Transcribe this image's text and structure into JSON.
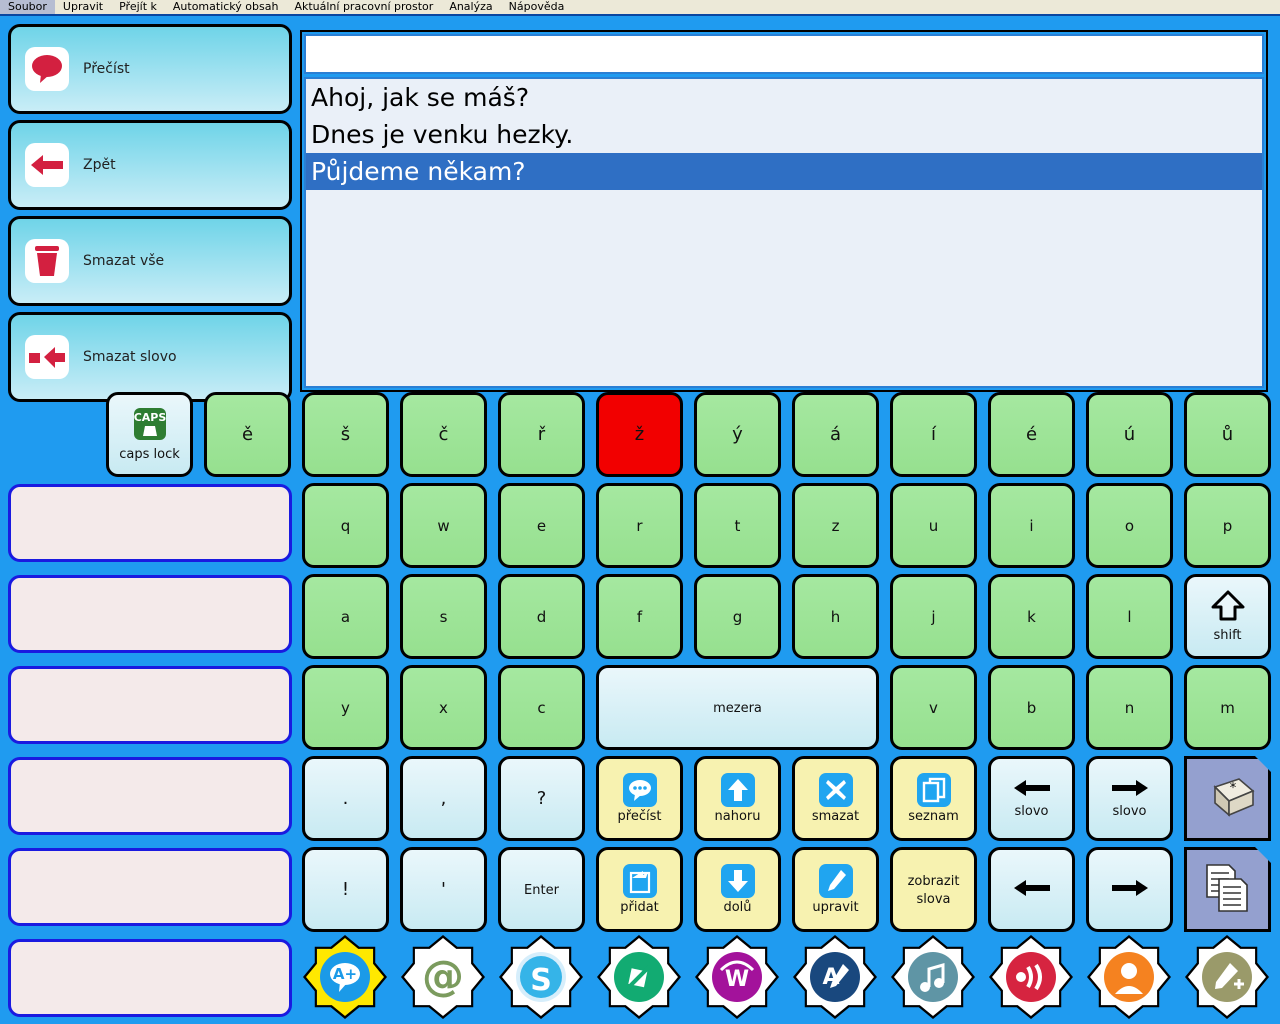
{
  "menu": {
    "items": [
      "Soubor",
      "Upravit",
      "Přejít k",
      "Automatický obsah",
      "Aktuální pracovní prostor",
      "Analýza",
      "Nápověda"
    ]
  },
  "sidebar": {
    "buttons": [
      {
        "label": "Přečíst",
        "icon": "speech-bubble-icon"
      },
      {
        "label": "Zpět",
        "icon": "arrow-left-icon"
      },
      {
        "label": "Smazat vše",
        "icon": "trash-icon"
      },
      {
        "label": "Smazat slovo",
        "icon": "delete-word-icon"
      }
    ],
    "empty_slots": 6
  },
  "text_area": {
    "entry_value": "",
    "sentences": [
      {
        "text": "Ahoj, jak se máš?",
        "selected": false
      },
      {
        "text": "Dnes je venku hezky.",
        "selected": false
      },
      {
        "text": "Půjdeme někam?",
        "selected": true
      }
    ]
  },
  "keyboard": {
    "caps": {
      "label": "caps lock",
      "badge": "CAPS",
      "icon": "caps-lock-icon"
    },
    "row1": [
      {
        "label": "ě",
        "style": "green"
      },
      {
        "label": "š",
        "style": "green"
      },
      {
        "label": "č",
        "style": "green"
      },
      {
        "label": "ř",
        "style": "green"
      },
      {
        "label": "ž",
        "style": "red"
      },
      {
        "label": "ý",
        "style": "green"
      },
      {
        "label": "á",
        "style": "green"
      },
      {
        "label": "í",
        "style": "green"
      },
      {
        "label": "é",
        "style": "green"
      },
      {
        "label": "ú",
        "style": "green"
      },
      {
        "label": "ů",
        "style": "green"
      }
    ],
    "row2": [
      "q",
      "w",
      "e",
      "r",
      "t",
      "z",
      "u",
      "i",
      "o",
      "p"
    ],
    "row3": [
      "a",
      "s",
      "d",
      "f",
      "g",
      "h",
      "j",
      "k",
      "l"
    ],
    "shift": {
      "label": "shift",
      "icon": "shift-arrow-icon"
    },
    "row4_left": [
      "y",
      "x",
      "c"
    ],
    "space": {
      "label": "mezera"
    },
    "row4_right": [
      "v",
      "b",
      "n",
      "m"
    ],
    "row5_punct": [
      {
        "label": ".",
        "name": "period"
      },
      {
        "label": ",",
        "name": "comma"
      },
      {
        "label": "?",
        "name": "question-mark"
      }
    ],
    "row6_punct": [
      {
        "label": "!",
        "name": "exclamation"
      },
      {
        "label": "'",
        "name": "apostrophe"
      },
      {
        "label": "Enter",
        "name": "enter"
      }
    ],
    "row5_func": [
      {
        "label": "přečíst",
        "icon": "speech-bubble-icon"
      },
      {
        "label": "nahoru",
        "icon": "arrow-up-icon"
      },
      {
        "label": "smazat",
        "icon": "close-x-icon"
      },
      {
        "label": "seznam",
        "icon": "copy-list-icon"
      }
    ],
    "row6_func": [
      {
        "label": "přidat",
        "icon": "add-page-icon"
      },
      {
        "label": "dolů",
        "icon": "arrow-down-icon"
      },
      {
        "label": "upravit",
        "icon": "pencil-icon"
      },
      {
        "label": "zobrazit slova",
        "icon": ""
      }
    ],
    "row5_nav": [
      {
        "label": "slovo",
        "icon": "arrow-left-icon"
      },
      {
        "label": "slovo",
        "icon": "arrow-right-icon"
      }
    ],
    "row6_nav": [
      {
        "label": "",
        "icon": "arrow-left-icon"
      },
      {
        "label": "",
        "icon": "arrow-right-icon"
      }
    ],
    "special_keys": [
      {
        "name": "keycap-star-icon"
      },
      {
        "name": "documents-icon"
      }
    ]
  },
  "app_bar": {
    "apps": [
      {
        "name": "a-plus-chat-icon",
        "disc": "#1b9ae8",
        "bg": "#ffe800",
        "selected": true
      },
      {
        "name": "email-at-icon",
        "disc": "#7b9b5e",
        "bg": "#ffffff",
        "selected": false
      },
      {
        "name": "skype-icon",
        "disc": "#35b4e8",
        "bg": "#ffffff",
        "selected": false
      },
      {
        "name": "media-note-icon",
        "disc": "#12ab72",
        "bg": "#ffffff",
        "selected": false
      },
      {
        "name": "wordweb-icon",
        "disc": "#a3129b",
        "bg": "#ffffff",
        "selected": false
      },
      {
        "name": "a-pencil-icon",
        "disc": "#19487e",
        "bg": "#ffffff",
        "selected": false
      },
      {
        "name": "music-icon",
        "disc": "#5f95a5",
        "bg": "#ffffff",
        "selected": false
      },
      {
        "name": "speaker-icon",
        "disc": "#d62440",
        "bg": "#ffffff",
        "selected": false
      },
      {
        "name": "user-icon",
        "disc": "#f58220",
        "bg": "#ffffff",
        "selected": false
      },
      {
        "name": "tools-icon",
        "disc": "#9a9a6a",
        "bg": "#ffffff",
        "selected": false
      }
    ]
  },
  "colors": {
    "background": "#1f9bf0",
    "key_green": "#a5e8a0",
    "key_red": "#f20000",
    "key_yellow": "#f7f2b0",
    "selection_blue": "#2f6fc4"
  }
}
